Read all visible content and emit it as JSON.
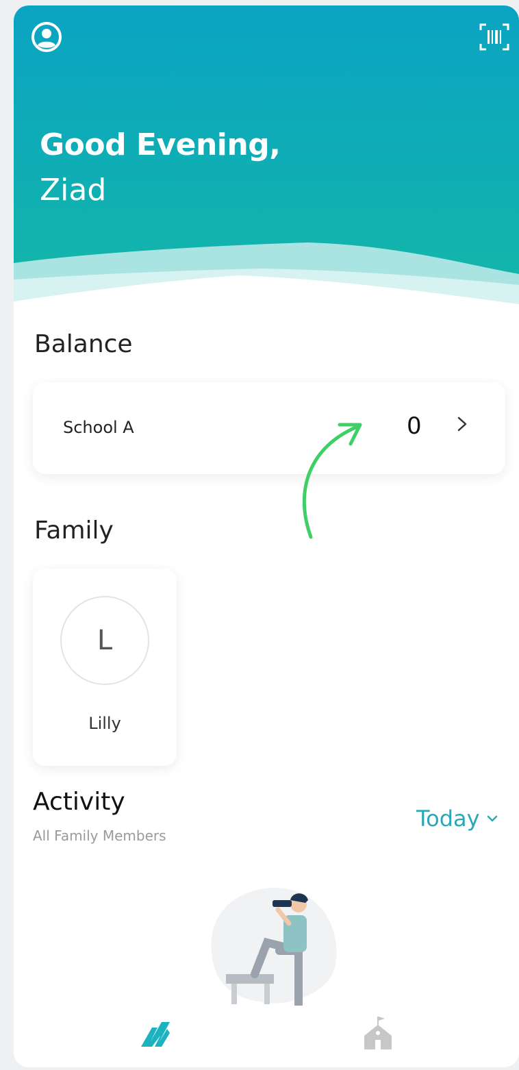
{
  "header": {
    "greeting": "Good Evening,",
    "username": "Ziad",
    "profile_icon": "user-circle-icon",
    "scan_icon": "barcode-scan-icon",
    "colors": {
      "top": "#0aa3c3",
      "bottom": "#14b7a8",
      "wave_light": "#c8eeee"
    }
  },
  "balance": {
    "title": "Balance",
    "school_name": "School A",
    "amount": "0",
    "chevron_icon": "chevron-right-icon"
  },
  "family": {
    "title": "Family",
    "members": [
      {
        "initial": "L",
        "name": "Lilly"
      }
    ]
  },
  "activity": {
    "title": "Activity",
    "subtitle": "All Family Members",
    "filter": "Today",
    "filter_icon": "chevron-down-icon",
    "accent": "#2ba8b6"
  },
  "nav": {
    "items": [
      {
        "icon": "app-logo-icon",
        "active": true,
        "color": "#1bb3c0"
      },
      {
        "icon": "school-building-icon",
        "active": false,
        "color": "#c7c7c7"
      }
    ]
  },
  "annotation": {
    "icon": "curved-arrow-icon",
    "color": "#3fcf66"
  }
}
